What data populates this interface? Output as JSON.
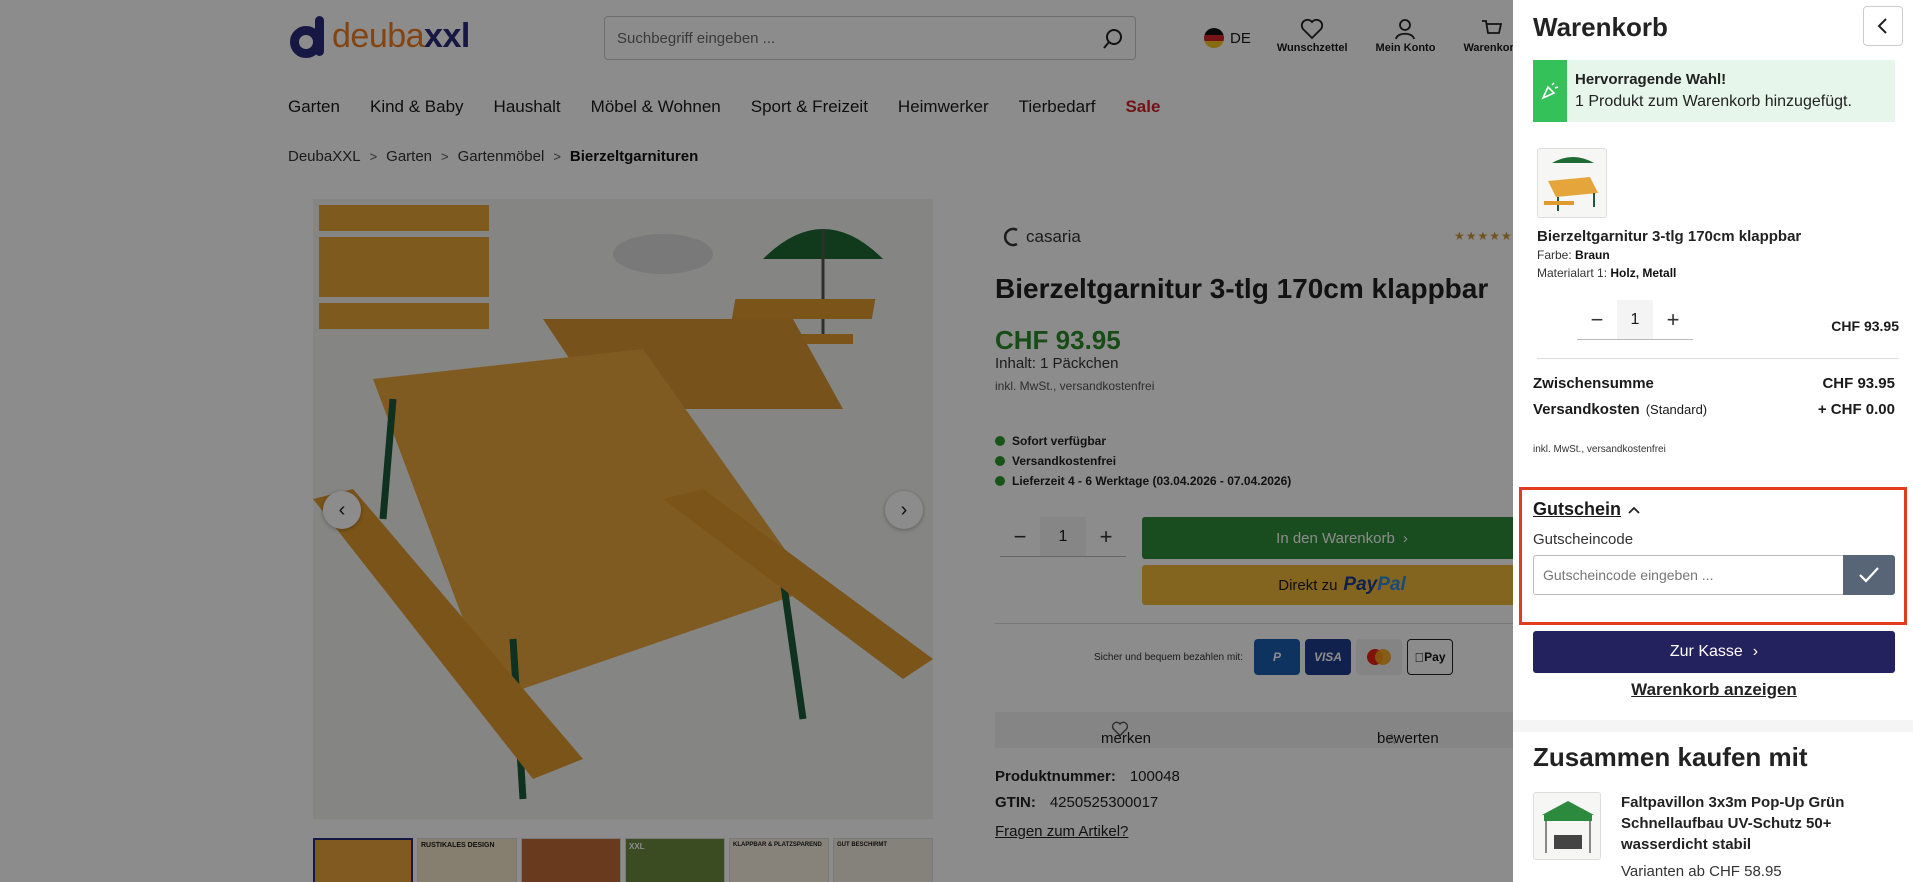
{
  "header": {
    "logo_part1": "deuba",
    "logo_part2": "xxl",
    "search_placeholder": "Suchbegriff eingeben ...",
    "language": "DE",
    "wishlist_label": "Wunschzettel",
    "account_label": "Mein Konto",
    "cart_label": "Warenkorb"
  },
  "nav": {
    "items": [
      "Garten",
      "Kind & Baby",
      "Haushalt",
      "Möbel & Wohnen",
      "Sport & Freizeit",
      "Heimwerker",
      "Tierbedarf"
    ],
    "sale": "Sale"
  },
  "breadcrumb": [
    "DeubaXXL",
    "Garten",
    "Gartenmöbel",
    "Bierzeltgarnituren"
  ],
  "product": {
    "brand": "casaria",
    "title": "Bierzeltgarnitur 3-tlg 170cm klappbar",
    "price": "CHF 93.95",
    "content": "Inhalt: 1 Päckchen",
    "tax_note": "inkl. MwSt., versandkostenfrei",
    "availability": [
      "Sofort verfügbar",
      "Versandkostenfrei",
      "Lieferzeit 4 - 6 Werktage (03.04.2026 - 07.04.2026)"
    ],
    "quantity": "1",
    "add_to_cart": "In den Warenkorb",
    "paypal_prefix": "Direkt zu",
    "paypal_brand_1": "Pay",
    "paypal_brand_2": "Pal",
    "payment_note": "Sicher und bequem bezahlen mit:",
    "payment_methods": [
      "P",
      "VISA",
      "",
      "Pay"
    ],
    "remember": "merken",
    "rate": "bewerten",
    "product_number_label": "Produktnummer:",
    "product_number": "100048",
    "gtin_label": "GTIN:",
    "gtin": "4250525300017",
    "questions_link": "Fragen zum Artikel?",
    "thumb_labels": [
      "",
      "RUSTIKALES DESIGN",
      "",
      "XXL",
      "KLAPPBAR & PLATZSPAREND",
      "GUT BESCHIRMT"
    ]
  },
  "cart": {
    "title": "Warenkorb",
    "success_title": "Hervorragende Wahl!",
    "success_text": "1 Produkt zum Warenkorb hinzugefügt.",
    "item": {
      "name": "Bierzeltgarnitur 3-tlg 170cm klappbar",
      "attr1_label": "Farbe:",
      "attr1_value": "Braun",
      "attr2_label": "Materialart 1:",
      "attr2_value": "Holz, Metall",
      "quantity": "1",
      "price": "CHF 93.95"
    },
    "subtotal_label": "Zwischensumme",
    "subtotal": "CHF 93.95",
    "shipping_label": "Versandkosten",
    "shipping_type": "(Standard)",
    "shipping": "+ CHF 0.00",
    "tax_note": "inkl. MwSt., versandkostenfrei",
    "voucher_title": "Gutschein",
    "voucher_label": "Gutscheincode",
    "voucher_placeholder": "Gutscheincode eingeben ...",
    "checkout": "Zur Kasse",
    "view_cart": "Warenkorb anzeigen",
    "cross_sell_title": "Zusammen kaufen mit",
    "cross_item_name": "Faltpavillon 3x3m Pop-Up Grün Schnellaufbau UV-Schutz 50+ wasserdicht stabil",
    "cross_item_price": "Varianten ab CHF 58.95"
  },
  "colors": {
    "brand_navy": "#23215e",
    "price_green": "#2b8a2b",
    "cart_button_green": "#2e8b3a",
    "paypal_yellow": "#f0b83a",
    "sale_red": "#d2232a",
    "highlight_red": "#e23b1f"
  }
}
